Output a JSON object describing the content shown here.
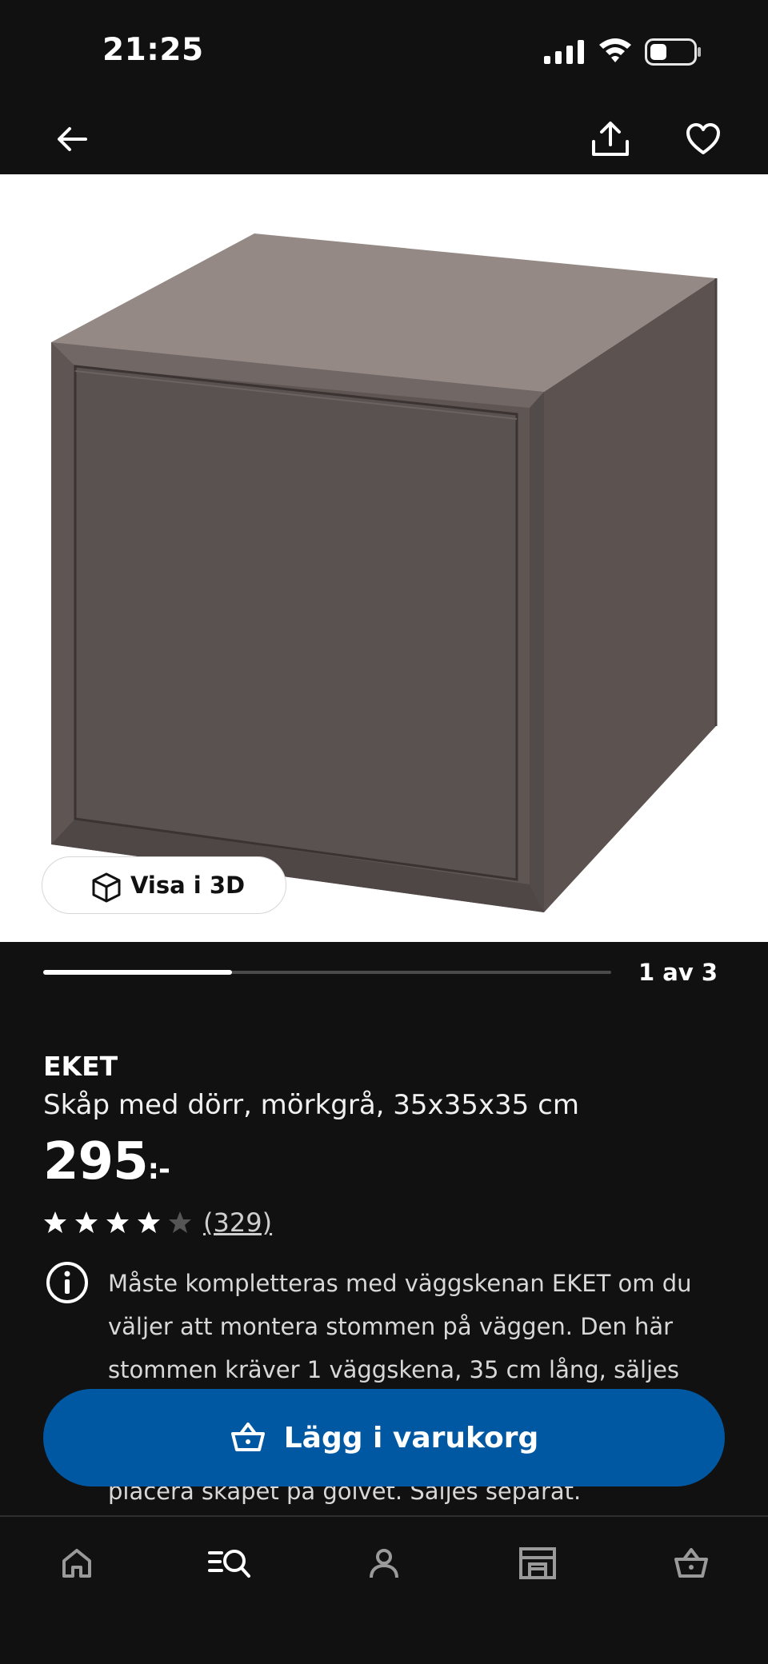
{
  "status_bar": {
    "time": "21:25",
    "icons": [
      "signal-icon",
      "wifi-icon",
      "battery-icon"
    ]
  },
  "header": {
    "icons": [
      "back-arrow-icon",
      "share-icon",
      "favorite-heart-icon"
    ]
  },
  "image_gallery": {
    "view_3d_label": "Visa i 3D",
    "pager_text": "1 av 3",
    "current_index": 1,
    "total": 3,
    "progress_fraction": 0.333
  },
  "product": {
    "name": "EKET",
    "description": "Skåp med dörr, mörkgrå, 35x35x35 cm",
    "price": "295",
    "price_suffix": ":-",
    "rating": 4,
    "rating_max": 5,
    "review_count": "(329)",
    "info_lines": [
      "Måste kompletteras med väggskenan EKET om du",
      "väljer att montera stommen på väggen. Den här",
      "stommen kräver 1 väggskena, 35 cm lång, säljes"
    ],
    "info_last_line": "placera skåpet på golvet. Säljes separat."
  },
  "cart_button": {
    "label": "Lägg i varukorg"
  },
  "bottom_nav": {
    "items": [
      "home-icon",
      "search-icon",
      "profile-icon",
      "store-icon",
      "cart-icon"
    ],
    "active": "search-icon"
  },
  "colors": {
    "background": "#111111",
    "primary_button": "#0058a3",
    "product": "#5a5250"
  }
}
